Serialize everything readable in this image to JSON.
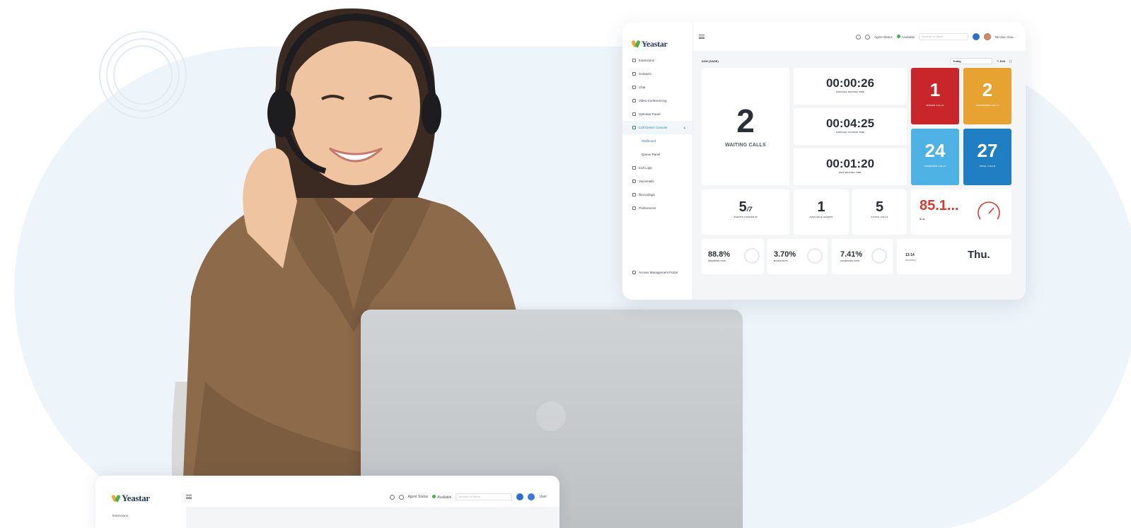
{
  "dashboard": {
    "brand": "Yeastar",
    "header": {
      "agent_status": "Agent Status",
      "available": "Available",
      "search_placeholder": "Number or Name",
      "user_name": "Nicolas Clau..."
    },
    "nav": [
      {
        "label": "Extensions",
        "icon": "user-icon"
      },
      {
        "label": "Contacts",
        "icon": "contacts-icon"
      },
      {
        "label": "Chat",
        "icon": "chat-icon"
      },
      {
        "label": "Video Conferencing",
        "icon": "video-icon"
      },
      {
        "label": "Operator Panel",
        "icon": "panel-icon"
      },
      {
        "label": "Call Center Console",
        "icon": "headset-icon"
      },
      {
        "label": "Wallboard",
        "icon": ""
      },
      {
        "label": "Queue Panel",
        "icon": ""
      },
      {
        "label": "Call Logs",
        "icon": "log-icon"
      },
      {
        "label": "Voicemails",
        "icon": "voicemail-icon"
      },
      {
        "label": "Recordings",
        "icon": "mic-icon"
      },
      {
        "label": "Preferences",
        "icon": "settings-icon"
      }
    ],
    "footer_link": "Access Management Portal",
    "breadcrumb": "6400 (SADE)",
    "period": "Today",
    "edit": "Edit",
    "waiting_calls": {
      "value": "2",
      "label": "WAITING CALLS"
    },
    "times": [
      {
        "value": "00:00:26",
        "label": "AVERAGE WAITING TIME"
      },
      {
        "value": "00:04:25",
        "label": "AVERAGE TALKING TIME"
      },
      {
        "value": "00:01:20",
        "label": "MAX WAITING TIME"
      }
    ],
    "counters": [
      {
        "value": "1",
        "label": "MISSED CALLS",
        "color": "#c9262b"
      },
      {
        "value": "2",
        "label": "ABANDONED CALLS",
        "color": "#e6a331"
      },
      {
        "value": "24",
        "label": "ANSWERED CALLS",
        "color": "#4eb3e4"
      },
      {
        "value": "27",
        "label": "TOTAL CALLS",
        "color": "#1f7fc2"
      }
    ],
    "agents_logged_in": {
      "value": "5",
      "total": "/7",
      "label": "AGENTS LOGGED IN"
    },
    "available_agents": {
      "value": "1",
      "label": "AVAILABLE AGENTS"
    },
    "active_calls": {
      "value": "5",
      "label": "ACTIVE CALLS"
    },
    "sla": {
      "value": "85.1...",
      "label": "SLA",
      "color": "#d93a2f"
    },
    "rates": [
      {
        "value": "88.8%",
        "label": "ANSWERED RATE"
      },
      {
        "value": "3.70%",
        "label": "MISSED RATE"
      },
      {
        "value": "7.41%",
        "label": "ABANDONED RATE"
      }
    ],
    "clock": {
      "time": "13:14",
      "date": "05/13/2021",
      "day": "Thu."
    }
  },
  "app2": {
    "brand": "Yeastar",
    "header": {
      "agent_status": "Agent Status",
      "available": "Available",
      "search_placeholder": "Number or Name",
      "user": "User"
    },
    "first_nav": "Extensions"
  }
}
